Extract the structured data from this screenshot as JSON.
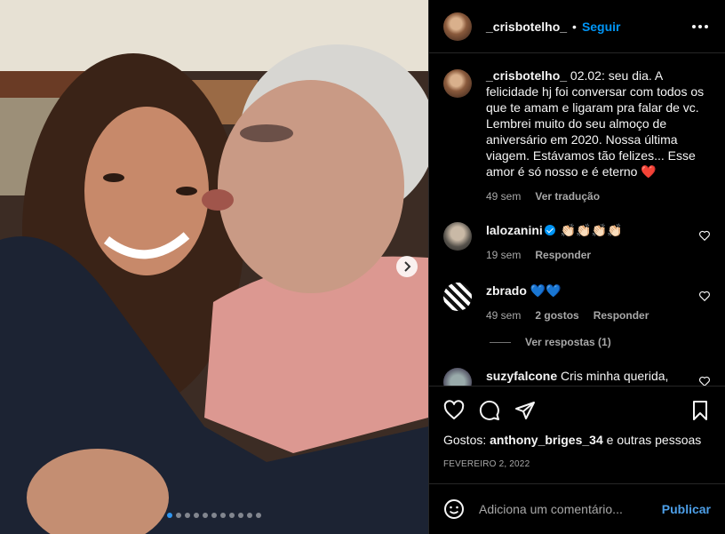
{
  "post": {
    "username": "_crisbotelho_",
    "separator": "•",
    "follow_label": "Seguir",
    "more_icon": "more-horizontal-icon"
  },
  "caption": {
    "username": "_crisbotelho_",
    "text": "02.02: seu dia. A felicidade hj foi conversar com todos os que te amam e ligaram pra falar de vc. Lembrei muito do seu almoço de aniversário em 2020. Nossa última viagem. Estávamos tão felizes... Esse amor é só nosso e é eterno",
    "heart_emoji": "❤️",
    "time": "49 sem",
    "translate_label": "Ver tradução"
  },
  "comments": [
    {
      "username": "lalozanini",
      "verified": true,
      "text": "👏🏻👏🏻👏🏻👏🏻",
      "time": "19 sem",
      "reply_label": "Responder"
    },
    {
      "username": "zbrado",
      "text": "💙💙",
      "time": "49 sem",
      "likes": "2 gostos",
      "reply_label": "Responder",
      "view_replies": "Ver respostas (1)"
    },
    {
      "username": "suzyfalcone",
      "text": "Cris minha querida,"
    }
  ],
  "likes": {
    "prefix": "Gostos:",
    "user": "anthony_briges_34",
    "suffix": "e outras pessoas"
  },
  "date": "FEVEREIRO 2, 2022",
  "add_comment": {
    "placeholder": "Adiciona um comentário...",
    "publish_label": "Publicar"
  },
  "carousel": {
    "total": 11,
    "active_index": 0
  },
  "colors": {
    "accent": "#0095f6",
    "background": "#000000",
    "heart": "#ed4956",
    "muted": "#a8a8a8"
  }
}
